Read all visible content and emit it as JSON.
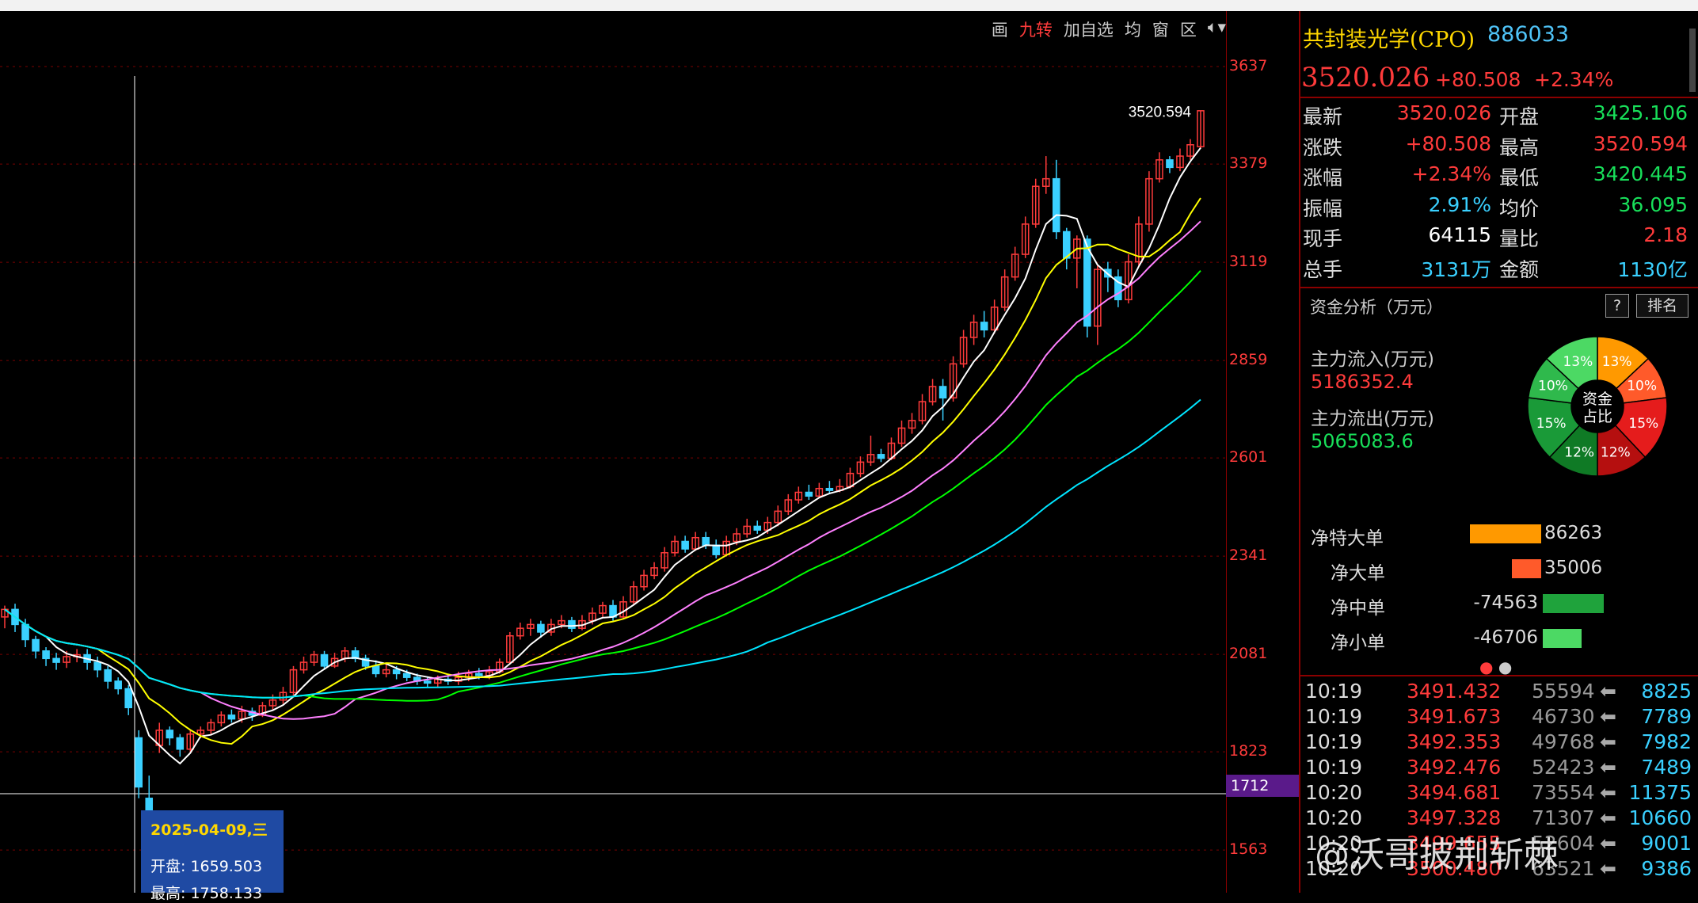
{
  "toolbar": {
    "items": [
      "画",
      "九转",
      "加自选",
      "均",
      "窗",
      "区"
    ],
    "active_index": 1
  },
  "header": {
    "name": "共封装光学(CPO)",
    "code": "886033",
    "price": "3520.026",
    "change": "+80.508",
    "pct": "+2.34%"
  },
  "quote": [
    {
      "l1": "最新",
      "v1": "3520.026",
      "c1": "red",
      "l2": "开盘",
      "v2": "3425.106",
      "c2": "green"
    },
    {
      "l1": "涨跌",
      "v1": "+80.508",
      "c1": "red",
      "l2": "最高",
      "v2": "3520.594",
      "c2": "red"
    },
    {
      "l1": "涨幅",
      "v1": "+2.34%",
      "c1": "red",
      "l2": "最低",
      "v2": "3420.445",
      "c2": "green"
    },
    {
      "l1": "振幅",
      "v1": "2.91%",
      "c1": "cyan",
      "l2": "均价",
      "v2": "36.095",
      "c2": "green"
    },
    {
      "l1": "现手",
      "v1": "64115",
      "c1": "white",
      "l2": "量比",
      "v2": "2.18",
      "c2": "red"
    },
    {
      "l1": "总手",
      "v1": "3131万",
      "c1": "cyan",
      "l2": "金额",
      "v2": "1130亿",
      "c2": "cyan"
    }
  ],
  "fund": {
    "title": "资金分析（万元）",
    "help_label": "?",
    "rank_label": "排名",
    "inflow_label": "主力流入(万元)",
    "inflow_value": "5186352.4",
    "outflow_label": "主力流出(万元)",
    "outflow_value": "5065083.6",
    "pie_center": [
      "资金",
      "占比"
    ],
    "pie_slices": [
      {
        "label": "13%",
        "pct": 13,
        "color": "#ff9900"
      },
      {
        "label": "10%",
        "pct": 10,
        "color": "#ff5a2a"
      },
      {
        "label": "15%",
        "pct": 15,
        "color": "#e51c1c"
      },
      {
        "label": "12%",
        "pct": 12,
        "color": "#b50f0f"
      },
      {
        "label": "12%",
        "pct": 12,
        "color": "#0f7a25"
      },
      {
        "label": "15%",
        "pct": 15,
        "color": "#1a9a38"
      },
      {
        "label": "10%",
        "pct": 10,
        "color": "#2fb94c"
      },
      {
        "label": "13%",
        "pct": 13,
        "color": "#4cd964"
      }
    ]
  },
  "orders": [
    {
      "label": "净特大单",
      "value": "86263",
      "bar_fraction": 1.0,
      "color": "#ff9900"
    },
    {
      "label": "净大单",
      "value": "35006",
      "bar_fraction": 0.41,
      "color": "#ff5a2a"
    },
    {
      "label": "净中单",
      "value": "-74563",
      "bar_fraction": 0.86,
      "color": "#1fa33c"
    },
    {
      "label": "净小单",
      "value": "-46706",
      "bar_fraction": 0.54,
      "color": "#4cd964"
    }
  ],
  "ticks": [
    {
      "time": "10:19",
      "price": "3491.432",
      "vol": "55594",
      "amt": "8825"
    },
    {
      "time": "10:19",
      "price": "3491.673",
      "vol": "46730",
      "amt": "7789"
    },
    {
      "time": "10:19",
      "price": "3492.353",
      "vol": "49768",
      "amt": "7982"
    },
    {
      "time": "10:19",
      "price": "3492.476",
      "vol": "52423",
      "amt": "7489"
    },
    {
      "time": "10:20",
      "price": "3494.681",
      "vol": "73554",
      "amt": "11375"
    },
    {
      "time": "10:20",
      "price": "3497.328",
      "vol": "71307",
      "amt": "10660"
    },
    {
      "time": "10:20",
      "price": "3499.655",
      "vol": "52604",
      "amt": "9001"
    },
    {
      "time": "10:20",
      "price": "3500.480",
      "vol": "63521",
      "amt": "9386"
    }
  ],
  "watermark": "@沃哥披荆斩棘",
  "tooltip": {
    "date": "2025-04-09,三",
    "open": "开盘: 1659.503",
    "high": "最高: 1758.133"
  },
  "chart_data": {
    "type": "candlestick",
    "y_ticks": [
      "3637",
      "3379",
      "3119",
      "2859",
      "2601",
      "2341",
      "2081",
      "1823",
      "1563"
    ],
    "ylim": [
      1450,
      3700
    ],
    "crosshair_value": "1712",
    "last_high_label": "3520.594",
    "candles": [
      [
        2180,
        2200,
        2150,
        2210
      ],
      [
        2200,
        2160,
        2140,
        2215
      ],
      [
        2160,
        2120,
        2100,
        2175
      ],
      [
        2120,
        2090,
        2070,
        2130
      ],
      [
        2090,
        2070,
        2050,
        2100
      ],
      [
        2070,
        2060,
        2040,
        2085
      ],
      [
        2060,
        2075,
        2045,
        2090
      ],
      [
        2075,
        2080,
        2060,
        2095
      ],
      [
        2080,
        2060,
        2040,
        2095
      ],
      [
        2060,
        2040,
        2020,
        2075
      ],
      [
        2040,
        2010,
        1990,
        2050
      ],
      [
        2010,
        1990,
        1975,
        2020
      ],
      [
        1990,
        1940,
        1920,
        2000
      ],
      [
        1860,
        1730,
        1700,
        1880
      ],
      [
        1700,
        1660,
        1650,
        1760
      ],
      [
        1840,
        1880,
        1820,
        1900
      ],
      [
        1880,
        1860,
        1840,
        1890
      ],
      [
        1860,
        1830,
        1810,
        1870
      ],
      [
        1830,
        1870,
        1820,
        1880
      ],
      [
        1870,
        1880,
        1860,
        1890
      ],
      [
        1880,
        1900,
        1870,
        1910
      ],
      [
        1900,
        1920,
        1890,
        1930
      ],
      [
        1920,
        1910,
        1900,
        1935
      ],
      [
        1910,
        1930,
        1900,
        1945
      ],
      [
        1930,
        1920,
        1905,
        1940
      ],
      [
        1920,
        1945,
        1915,
        1955
      ],
      [
        1945,
        1960,
        1935,
        1975
      ],
      [
        1960,
        1980,
        1950,
        1995
      ],
      [
        1980,
        2040,
        1970,
        2050
      ],
      [
        2040,
        2060,
        2030,
        2075
      ],
      [
        2060,
        2080,
        2050,
        2090
      ],
      [
        2080,
        2050,
        2040,
        2090
      ],
      [
        2050,
        2070,
        2045,
        2085
      ],
      [
        2070,
        2090,
        2060,
        2100
      ],
      [
        2090,
        2070,
        2060,
        2100
      ],
      [
        2070,
        2050,
        2040,
        2080
      ],
      [
        2050,
        2030,
        2020,
        2065
      ],
      [
        2030,
        2040,
        2020,
        2055
      ],
      [
        2040,
        2030,
        2015,
        2050
      ],
      [
        2030,
        2020,
        2010,
        2040
      ],
      [
        2020,
        2010,
        2000,
        2030
      ],
      [
        2010,
        2005,
        1995,
        2020
      ],
      [
        2005,
        2015,
        1995,
        2025
      ],
      [
        2015,
        2010,
        2000,
        2030
      ],
      [
        2010,
        2020,
        2000,
        2035
      ],
      [
        2020,
        2030,
        2010,
        2040
      ],
      [
        2030,
        2025,
        2015,
        2045
      ],
      [
        2025,
        2035,
        2015,
        2050
      ],
      [
        2035,
        2060,
        2030,
        2070
      ],
      [
        2060,
        2130,
        2055,
        2140
      ],
      [
        2130,
        2150,
        2120,
        2165
      ],
      [
        2150,
        2160,
        2130,
        2175
      ],
      [
        2160,
        2140,
        2125,
        2170
      ],
      [
        2140,
        2160,
        2130,
        2175
      ],
      [
        2160,
        2170,
        2150,
        2185
      ],
      [
        2170,
        2150,
        2140,
        2180
      ],
      [
        2150,
        2170,
        2145,
        2185
      ],
      [
        2170,
        2190,
        2160,
        2205
      ],
      [
        2190,
        2210,
        2180,
        2220
      ],
      [
        2210,
        2180,
        2170,
        2225
      ],
      [
        2180,
        2220,
        2175,
        2235
      ],
      [
        2220,
        2260,
        2210,
        2275
      ],
      [
        2260,
        2290,
        2250,
        2305
      ],
      [
        2290,
        2310,
        2280,
        2325
      ],
      [
        2310,
        2350,
        2300,
        2365
      ],
      [
        2350,
        2380,
        2340,
        2395
      ],
      [
        2380,
        2360,
        2350,
        2395
      ],
      [
        2360,
        2390,
        2355,
        2405
      ],
      [
        2390,
        2370,
        2360,
        2405
      ],
      [
        2370,
        2345,
        2335,
        2385
      ],
      [
        2345,
        2380,
        2340,
        2395
      ],
      [
        2380,
        2400,
        2370,
        2415
      ],
      [
        2400,
        2420,
        2390,
        2440
      ],
      [
        2420,
        2410,
        2400,
        2435
      ],
      [
        2410,
        2430,
        2400,
        2445
      ],
      [
        2430,
        2460,
        2420,
        2475
      ],
      [
        2460,
        2490,
        2450,
        2505
      ],
      [
        2490,
        2510,
        2480,
        2525
      ],
      [
        2510,
        2500,
        2490,
        2530
      ],
      [
        2500,
        2520,
        2495,
        2535
      ],
      [
        2520,
        2515,
        2505,
        2540
      ],
      [
        2515,
        2525,
        2510,
        2545
      ],
      [
        2525,
        2560,
        2520,
        2575
      ],
      [
        2560,
        2590,
        2550,
        2605
      ],
      [
        2590,
        2610,
        2580,
        2660
      ],
      [
        2610,
        2600,
        2590,
        2625
      ],
      [
        2600,
        2640,
        2595,
        2655
      ],
      [
        2640,
        2680,
        2630,
        2700
      ],
      [
        2680,
        2700,
        2665,
        2720
      ],
      [
        2700,
        2750,
        2690,
        2770
      ],
      [
        2750,
        2790,
        2740,
        2810
      ],
      [
        2790,
        2760,
        2700,
        2810
      ],
      [
        2760,
        2850,
        2750,
        2870
      ],
      [
        2850,
        2920,
        2840,
        2940
      ],
      [
        2920,
        2960,
        2900,
        2980
      ],
      [
        2960,
        2940,
        2920,
        2990
      ],
      [
        2940,
        3000,
        2930,
        3020
      ],
      [
        3000,
        3080,
        2990,
        3100
      ],
      [
        3080,
        3140,
        3070,
        3160
      ],
      [
        3140,
        3220,
        3130,
        3240
      ],
      [
        3220,
        3320,
        3210,
        3340
      ],
      [
        3320,
        3340,
        3300,
        3400
      ],
      [
        3340,
        3200,
        3180,
        3390
      ],
      [
        3200,
        3130,
        3100,
        3210
      ],
      [
        3130,
        3180,
        3050,
        3190
      ],
      [
        3180,
        2950,
        2920,
        3190
      ],
      [
        2950,
        3100,
        2900,
        3110
      ],
      [
        3100,
        3080,
        3040,
        3120
      ],
      [
        3080,
        3020,
        3000,
        3100
      ],
      [
        3020,
        3120,
        3010,
        3140
      ],
      [
        3120,
        3220,
        3110,
        3240
      ],
      [
        3220,
        3340,
        3200,
        3360
      ],
      [
        3340,
        3390,
        3330,
        3410
      ],
      [
        3390,
        3370,
        3355,
        3400
      ],
      [
        3370,
        3400,
        3360,
        3420
      ],
      [
        3400,
        3430,
        3390,
        3445
      ],
      [
        3425,
        3520,
        3420,
        3520
      ]
    ],
    "ma_lines": [
      {
        "name": "MA5",
        "color": "#ffffff"
      },
      {
        "name": "MA10",
        "color": "#ffff00"
      },
      {
        "name": "MA20",
        "color": "#ff80ff"
      },
      {
        "name": "MA30",
        "color": "#00ff00"
      },
      {
        "name": "MA60",
        "color": "#00e5ff"
      }
    ]
  }
}
